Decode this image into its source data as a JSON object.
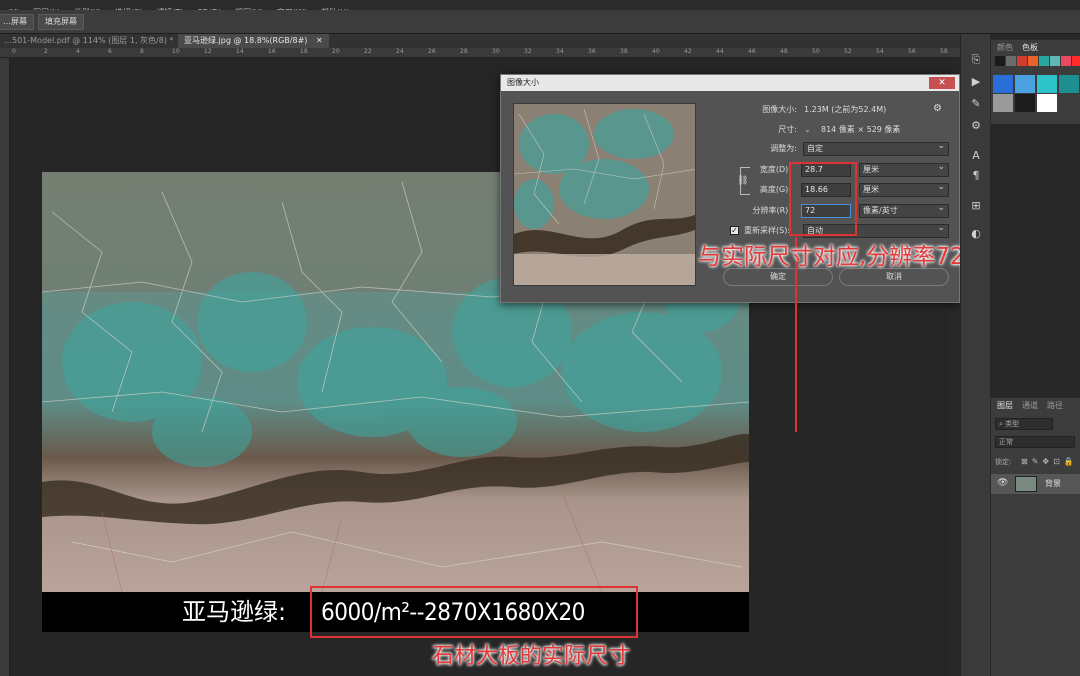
{
  "menubar": {
    "items": [
      "…(Y)",
      "图层(L)",
      "类型(Y)",
      "选择(S)",
      "滤镜(T)",
      "3D(D)",
      "视图(V)",
      "窗口(W)",
      "帮助(H)"
    ]
  },
  "options_bar": {
    "buttons": [
      "…屏幕",
      "填充屏幕"
    ]
  },
  "document_tabs": [
    {
      "label": "…501-Model.pdf @ 114% (图层 1, 灰色/8) *",
      "active": false
    },
    {
      "label": "亚马逊绿.jpg @ 18.8%(RGB/8#)",
      "active": true
    }
  ],
  "ruler": {
    "labels": [
      "0",
      "2",
      "4",
      "6",
      "8",
      "10",
      "12",
      "14",
      "16",
      "18",
      "20",
      "22",
      "24",
      "26",
      "28",
      "30",
      "32",
      "34",
      "36",
      "38",
      "40",
      "42",
      "44",
      "46",
      "48",
      "50",
      "52",
      "54",
      "56",
      "58"
    ]
  },
  "canvas": {
    "caption_label": "亚马逊绿:",
    "caption_value": "6000/m²--2870X1680X20",
    "annotation_bottom": "石材大板的实际尺寸",
    "annotation_dialog": "与实际尺寸对应,分辨率72"
  },
  "dialog": {
    "title": "图像大小",
    "close": "✕",
    "image_size_label": "图像大小:",
    "image_size_value": "1.23M (之前为52.4M)",
    "dimensions_label": "尺寸:",
    "dimensions_value": "814 像素 × 529 像素",
    "fit_label": "调整为:",
    "fit_value": "自定",
    "width_label": "宽度(D):",
    "width_value": "28.7",
    "width_unit": "厘米",
    "height_label": "高度(G):",
    "height_value": "18.66",
    "height_unit": "厘米",
    "resolution_label": "分辨率(R):",
    "resolution_value": "72",
    "resolution_unit": "像素/英寸",
    "resample_label": "重新采样(S):",
    "resample_value": "自动",
    "ok_label": "确定",
    "cancel_label": "取消"
  },
  "panels": {
    "color_tabs": [
      "颜色",
      "色板"
    ],
    "layers_tabs": [
      "图层",
      "通道",
      "路径"
    ],
    "layer_search": "类型",
    "blend_mode": "正常",
    "lock_label": "锁定:",
    "layer_name": "背景"
  },
  "swatch_colors": [
    "#1a1a1a",
    "#6b6b6b",
    "#d23b2e",
    "#e8622c",
    "#2aa6a0",
    "#5fb8b5",
    "#e84a5f",
    "#ff2a2a",
    "#2a6ed8",
    "#4aa3e0",
    "#2ec3c8",
    "#1e8f90",
    "#000000",
    "#ffffff",
    "#e03030",
    "#c8c8c8",
    "#9a9a9a",
    "#1c1c1c",
    "#ffffff"
  ],
  "accent": {
    "annotation_red": "#e03232"
  }
}
